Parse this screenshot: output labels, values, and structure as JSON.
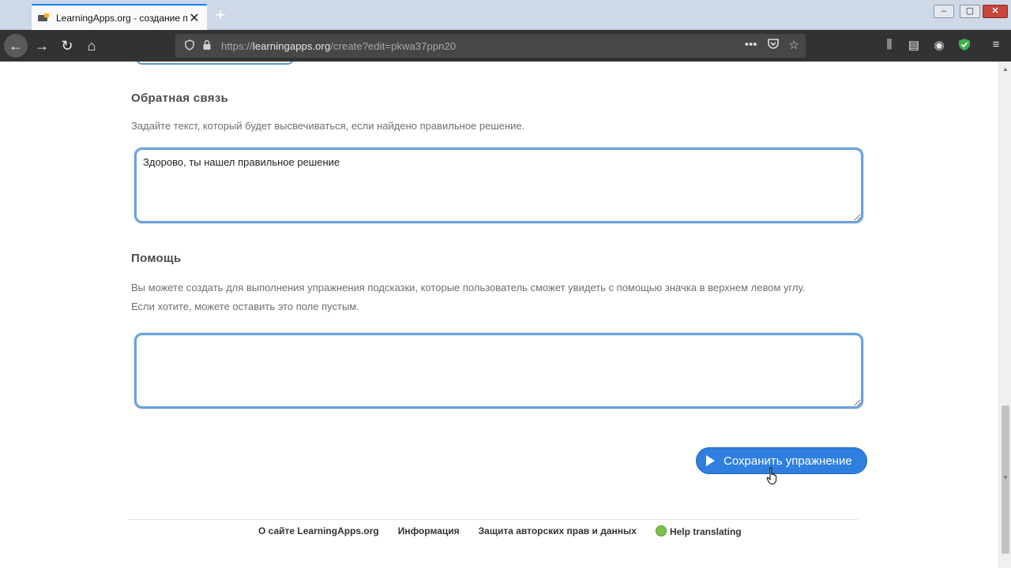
{
  "browser": {
    "tab_title": "LearningApps.org - создание п",
    "tab_close": "✕",
    "new_tab": "+",
    "url_prefix": "https://",
    "url_host": "learningapps.org",
    "url_path": "/create?edit=pkwa37ppn20",
    "win_min": "–",
    "win_max": "▢",
    "win_close": "✕"
  },
  "icons": {
    "back": "←",
    "forward": "→",
    "reload": "↻",
    "home": "⌂",
    "shield": "⛉",
    "lock": "🔒",
    "more": "•••",
    "pocket": "⛉",
    "star": "☆",
    "library": "⫼",
    "sidebar": "▤",
    "account": "◉",
    "protect": "✓",
    "menu": "≡"
  },
  "feedback": {
    "heading": "Обратная связь",
    "description": "Задайте текст, который будет высвечиваться, если найдено правильное решение.",
    "value": "Здорово, ты нашел правильное решение"
  },
  "help": {
    "heading": "Помощь",
    "description_line1": "Вы можете создать для выполнения упражнения подсказки, которые пользователь сможет увидеть с помощью значка в верхнем левом углу.",
    "description_line2": "Если хотите, можете оставить это поле пустым.",
    "value": ""
  },
  "actions": {
    "save_label": "Сохранить упражнение"
  },
  "footer": {
    "about": "О сайте LearningApps.org",
    "info": "Информация",
    "privacy": "Защита авторских прав и данных",
    "translate": "Help translating"
  },
  "colors": {
    "accent": "#2f7fe0",
    "textarea_border": "#6aa2de"
  }
}
